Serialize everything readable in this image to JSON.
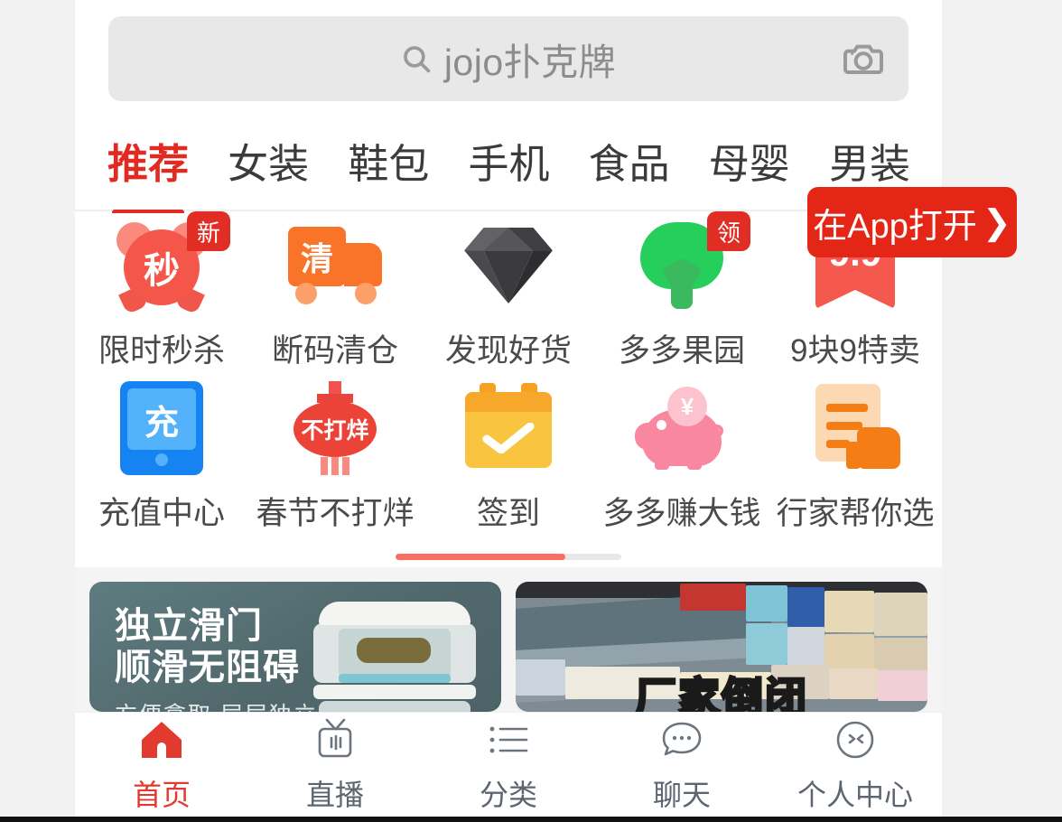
{
  "search": {
    "query": "jojo扑克牌",
    "search_icon": "search-icon",
    "camera_icon": "camera-icon"
  },
  "tabs": [
    {
      "label": "推荐",
      "active": true
    },
    {
      "label": "女装",
      "active": false
    },
    {
      "label": "鞋包",
      "active": false
    },
    {
      "label": "手机",
      "active": false
    },
    {
      "label": "食品",
      "active": false
    },
    {
      "label": "母婴",
      "active": false
    },
    {
      "label": "男装",
      "active": false
    }
  ],
  "app_open": {
    "label": "在App打开",
    "chevron": "❯",
    "background": "#e42617",
    "text_color": "#ffffff"
  },
  "grid": {
    "row1": [
      {
        "label": "限时秒杀",
        "icon": "alarm-clock-icon",
        "glyph": "秒",
        "badge": "新"
      },
      {
        "label": "断码清仓",
        "icon": "truck-icon",
        "glyph": "清",
        "badge": ""
      },
      {
        "label": "发现好货",
        "icon": "diamond-icon",
        "glyph": "",
        "badge": ""
      },
      {
        "label": "多多果园",
        "icon": "tree-icon",
        "glyph": "",
        "badge": "领"
      },
      {
        "label": "9块9特卖",
        "icon": "ribbon-icon",
        "glyph": "9.9",
        "badge": ""
      }
    ],
    "row2": [
      {
        "label": "充值中心",
        "icon": "phone-recharge-icon",
        "glyph": "充",
        "badge": ""
      },
      {
        "label": "春节不打烊",
        "icon": "lantern-icon",
        "glyph": "不打烊",
        "badge": ""
      },
      {
        "label": "签到",
        "icon": "calendar-check-icon",
        "glyph": "",
        "badge": ""
      },
      {
        "label": "多多赚大钱",
        "icon": "piggy-bank-icon",
        "glyph": "¥",
        "badge": ""
      },
      {
        "label": "行家帮你选",
        "icon": "document-thumbsup-icon",
        "glyph": "",
        "badge": ""
      }
    ],
    "pagination": {
      "progress_percent": 75,
      "active_color": "#fa6d61",
      "track_color": "#e8e8e8"
    }
  },
  "banners": [
    {
      "name": "食品容器促销",
      "line1": "独立滑门",
      "line2": "顺滑无阻碍",
      "line3": "方便拿取 层层独立",
      "background": "#51696d"
    },
    {
      "name": "厂家倒闭清仓",
      "headline": "厂家倒闭",
      "background": "#7e8b93",
      "headline_color": "#ffe600"
    }
  ],
  "bottom_nav": [
    {
      "label": "首页",
      "icon": "home-icon",
      "active": true
    },
    {
      "label": "直播",
      "icon": "tv-live-icon",
      "active": false
    },
    {
      "label": "分类",
      "icon": "list-category-icon",
      "active": false
    },
    {
      "label": "聊天",
      "icon": "chat-bubble-icon",
      "active": false
    },
    {
      "label": "个人中心",
      "icon": "user-profile-icon",
      "active": false
    }
  ],
  "theme": {
    "accent_red": "#e12a21",
    "page_background": "#f2f2f2",
    "content_background": "#ffffff"
  }
}
